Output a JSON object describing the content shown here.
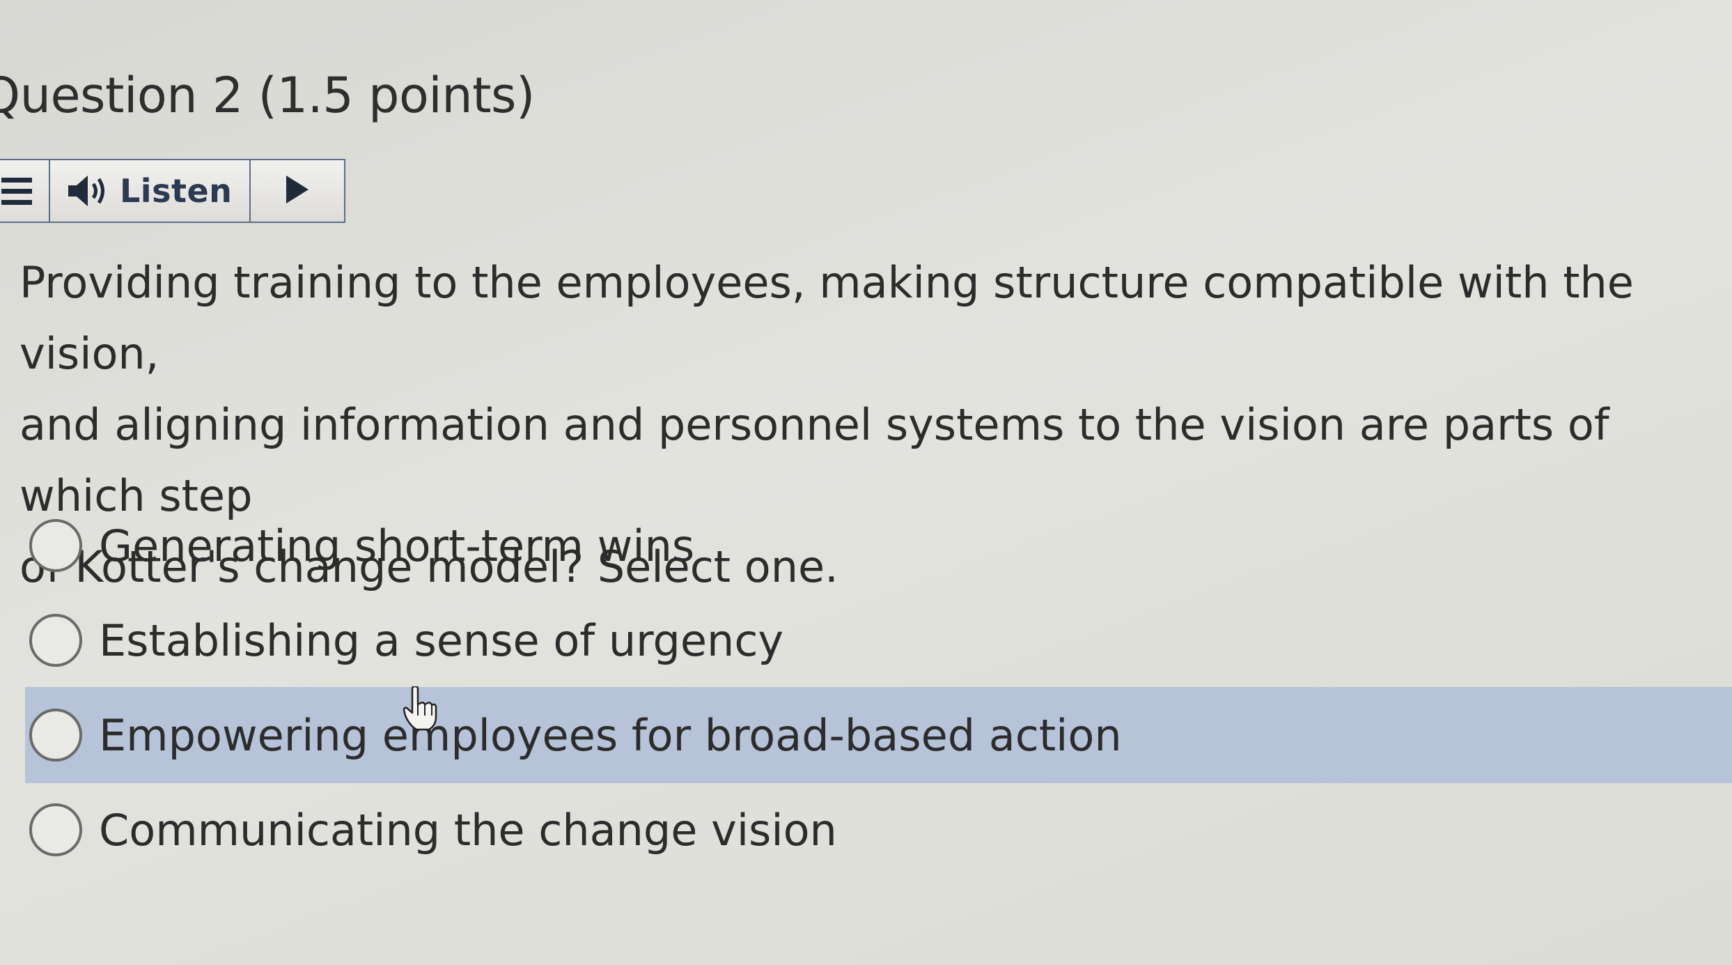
{
  "question": {
    "title": "Question 2",
    "points": "(1.5 points)",
    "text": "Providing training to the employees, making structure compatible with the vision,\nand aligning information and personnel systems to the vision are parts of which step\nof Kotter's change model? Select one."
  },
  "toolbar": {
    "listen_label": "Listen",
    "icons": [
      "menu-icon",
      "speaker-icon",
      "play-icon"
    ]
  },
  "options": [
    {
      "label": "Generating short-term wins",
      "highlighted": false
    },
    {
      "label": "Establishing a sense of urgency",
      "highlighted": false
    },
    {
      "label": "Empowering employees for broad-based action",
      "highlighted": true
    },
    {
      "label": "Communicating the change vision",
      "highlighted": false
    }
  ],
  "colors": {
    "highlight": "#b6c3d8",
    "toolbar_border": "#5a6e86"
  }
}
